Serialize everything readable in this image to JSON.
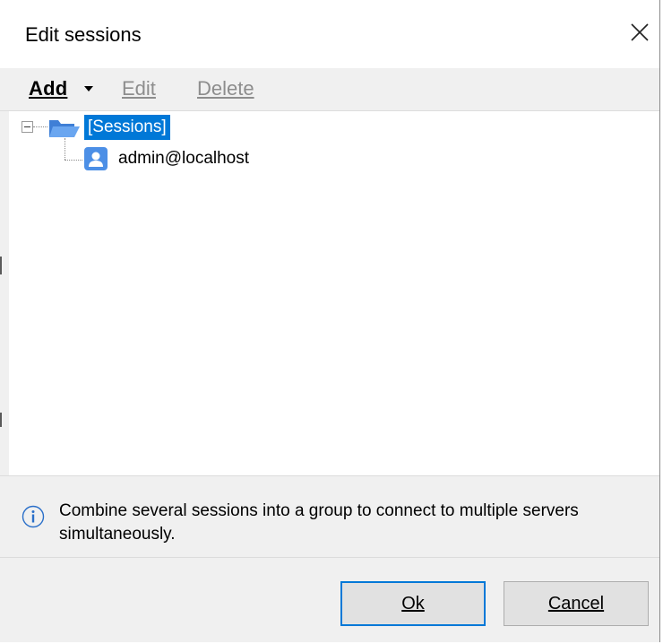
{
  "window": {
    "title": "Edit sessions"
  },
  "toolbar": {
    "add_label": "Add",
    "edit_label": "Edit",
    "delete_label": "Delete"
  },
  "tree": {
    "root_label": "[Sessions]",
    "items": [
      {
        "label": "admin@localhost",
        "icon": "user-icon"
      }
    ]
  },
  "info": {
    "text": "Combine several sessions into a group to connect to multiple servers simultaneously."
  },
  "buttons": {
    "ok_label": "Ok",
    "cancel_label": "Cancel"
  },
  "colors": {
    "selection": "#0078d7",
    "folder": "#4c8fe6",
    "disabled_text": "#8d8d8d"
  }
}
